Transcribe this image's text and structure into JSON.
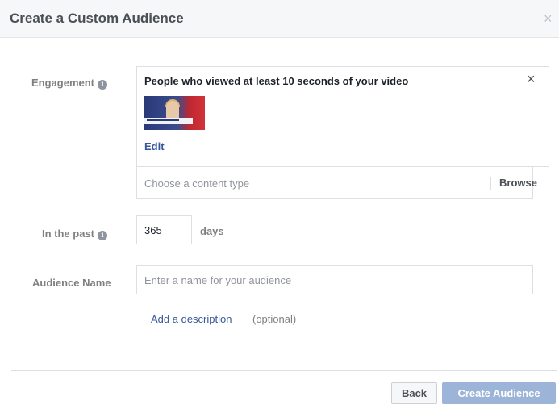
{
  "dialog": {
    "title": "Create a Custom Audience",
    "close_glyph": "×",
    "accent_color": "#365899"
  },
  "engagement": {
    "label": "Engagement",
    "info_glyph": "i",
    "rule_text": "People who viewed at least 10 seconds of your video",
    "remove_glyph": "×",
    "edit_label": "Edit",
    "content_type_placeholder": "Choose a content type",
    "browse_label": "Browse"
  },
  "in_the_past": {
    "label": "In the past",
    "info_glyph": "i",
    "value": "365",
    "unit": "days"
  },
  "audience_name": {
    "label": "Audience Name",
    "placeholder": "Enter a name for your audience",
    "add_description_label": "Add a description",
    "optional_label": "(optional)"
  },
  "footer": {
    "back_label": "Back",
    "create_label": "Create Audience",
    "create_disabled_color": "#9cb4d8"
  }
}
